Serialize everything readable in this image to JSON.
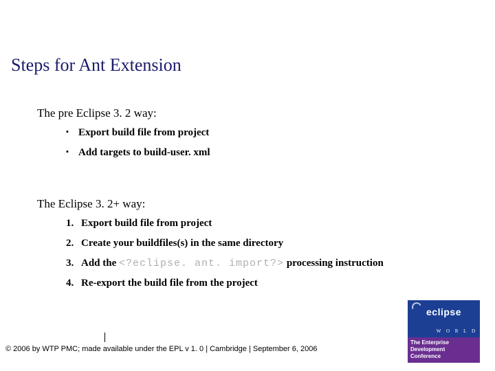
{
  "title": "Steps for Ant Extension",
  "section1": {
    "head": "The pre Eclipse 3. 2 way:",
    "items": [
      "Export build file from project",
      "Add targets to build-user. xml"
    ]
  },
  "section2": {
    "head": "The Eclipse 3. 2+ way:",
    "items": [
      {
        "text": "Export build file from project"
      },
      {
        "text": "Create your buildfiles(s) in the same directory"
      },
      {
        "prefix": "Add the ",
        "code": "<?eclipse. ant. import?>",
        "suffix": "  processing instruction"
      },
      {
        "text": "Re-export the build file from the project"
      }
    ]
  },
  "footer": "© 2006 by WTP PMC; made available under the EPL v 1. 0  |  Cambridge  |  September 6, 2006",
  "logo": {
    "brand": "eclipse",
    "sub": "W O R L D",
    "tag1": "The Enterprise",
    "tag2": "Development",
    "tag3": "Conference"
  }
}
